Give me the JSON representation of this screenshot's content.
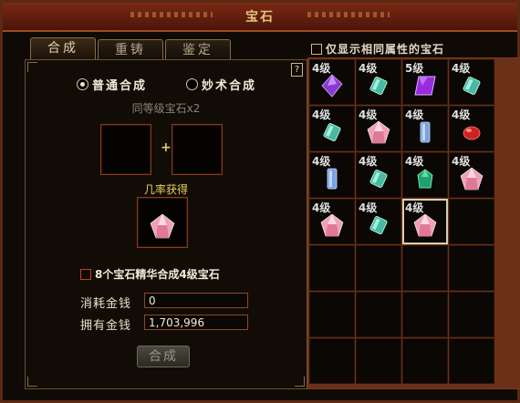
{
  "window": {
    "title": "宝石"
  },
  "tabs": [
    {
      "label": "合成",
      "active": true
    },
    {
      "label": "重铸",
      "active": false
    },
    {
      "label": "鉴定",
      "active": false
    }
  ],
  "left": {
    "help_label": "?",
    "modes": [
      {
        "label": "普通合成",
        "selected": true
      },
      {
        "label": "妙术合成",
        "selected": false
      }
    ],
    "requirement": "同等级宝石x2",
    "plus": "+",
    "result_label": "几率获得",
    "essence_option": {
      "label": "8个宝石精华合成4级宝石",
      "checked": false
    },
    "cost": {
      "label": "消耗金钱",
      "value": "0"
    },
    "owned": {
      "label": "拥有金钱",
      "value": "1,703,996"
    },
    "compose_button": "合成"
  },
  "right": {
    "filter": {
      "label": "仅显示相同属性的宝石",
      "checked": false
    },
    "gems": [
      {
        "level": "4级",
        "icon": "purple-diamond-gem-icon",
        "color": "#8a3ad0"
      },
      {
        "level": "4级",
        "icon": "teal-cylinder-gem-icon",
        "color": "#4ab8a0"
      },
      {
        "level": "5级",
        "icon": "purple-square-gem-icon",
        "color": "#9a2ae0"
      },
      {
        "level": "4级",
        "icon": "teal-cylinder-gem-icon",
        "color": "#4ab8a0"
      },
      {
        "level": "4级",
        "icon": "teal-cylinder-gem-icon",
        "color": "#4ab8a0"
      },
      {
        "level": "4级",
        "icon": "pink-crystal-gem-icon",
        "color": "#f0a0b8"
      },
      {
        "level": "4级",
        "icon": "blue-prism-gem-icon",
        "color": "#7aa0e0"
      },
      {
        "level": "4级",
        "icon": "red-oval-gem-icon",
        "color": "#d02020"
      },
      {
        "level": "4级",
        "icon": "blue-prism-gem-icon",
        "color": "#7aa0e0"
      },
      {
        "level": "4级",
        "icon": "teal-cylinder-gem-icon",
        "color": "#4ab8a0"
      },
      {
        "level": "4级",
        "icon": "green-emerald-gem-icon",
        "color": "#20a070"
      },
      {
        "level": "4级",
        "icon": "pink-crystal-gem-icon",
        "color": "#f0a0b8"
      },
      {
        "level": "4级",
        "icon": "pink-crystal-gem-icon",
        "color": "#f0a0b8"
      },
      {
        "level": "4级",
        "icon": "teal-cylinder-gem-icon",
        "color": "#4ab8a0"
      },
      {
        "level": "4级",
        "icon": "pink-crystal-gem-icon",
        "color": "#f0a0b8",
        "selected": true
      }
    ],
    "total_slots": 28
  }
}
